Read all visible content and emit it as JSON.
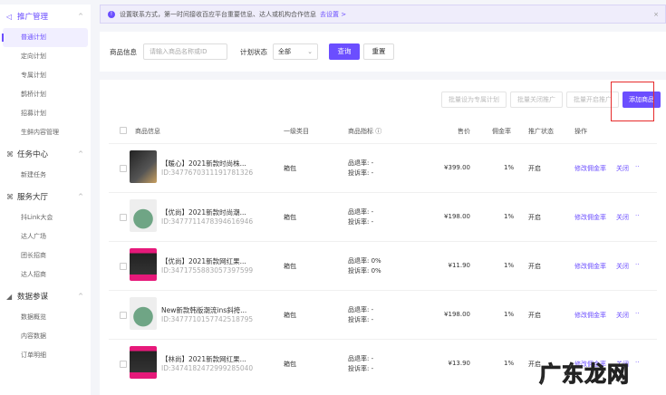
{
  "sidebar": {
    "groups": [
      {
        "label": "推广管理",
        "icon": "megaphone-icon",
        "items": [
          "普通计划",
          "定向计划",
          "专属计划",
          "鹊桥计划",
          "招募计划",
          "生鲜内容管理"
        ]
      },
      {
        "label": "任务中心",
        "icon": "grid-icon",
        "items": [
          "新建任务"
        ]
      },
      {
        "label": "服务大厅",
        "icon": "grid-icon",
        "items": [
          "抖Link大会",
          "达人广场",
          "团长招商",
          "达人招商"
        ]
      },
      {
        "label": "数据参谋",
        "icon": "chart-icon",
        "items": [
          "数据概览",
          "内容数据",
          "订单明细"
        ]
      }
    ]
  },
  "banner": {
    "text": "设置联系方式，第一时间接收百应平台重要信息、达人或机构合作信息",
    "link": "去设置 >",
    "close": "×"
  },
  "filter": {
    "product_label": "商品信息",
    "product_placeholder": "请输入商品名称或ID",
    "status_label": "计划状态",
    "status_value": "全部",
    "query": "查询",
    "reset": "重置"
  },
  "actions": {
    "batch_exclusive": "批量设为专属计划",
    "batch_close": "批量关闭推广",
    "batch_open": "批量开启推广",
    "add": "添加商品"
  },
  "table": {
    "headers": [
      "商品信息",
      "一级类目",
      "商品指标 ⓘ",
      "售价",
      "佣金率",
      "推广状态",
      "操作"
    ],
    "rows": [
      {
        "name": "【暖心】2021新款时尚株...",
        "id": "ID:3477670311191781326",
        "category": "箱包",
        "refund": "品退率: -",
        "complaint": "投诉率: -",
        "price": "¥399.00",
        "rate": "1%",
        "status": "开启",
        "thumb": "t1"
      },
      {
        "name": "【优尚】2021新款时尚潮...",
        "id": "ID:3477711478394616946",
        "category": "箱包",
        "refund": "品退率: -",
        "complaint": "投诉率: -",
        "price": "¥198.00",
        "rate": "1%",
        "status": "开启",
        "thumb": "t2"
      },
      {
        "name": "【优尚】2021新款网红果...",
        "id": "ID:3471755883057397599",
        "category": "箱包",
        "refund": "品退率: 0%",
        "complaint": "投诉率: 0%",
        "price": "¥11.90",
        "rate": "1%",
        "status": "开启",
        "thumb": "t3"
      },
      {
        "name": "New新款韩版潮流ins斜挎...",
        "id": "ID:3477710157742518795",
        "category": "箱包",
        "refund": "品退率: -",
        "complaint": "投诉率: -",
        "price": "¥198.00",
        "rate": "1%",
        "status": "开启",
        "thumb": "t2"
      },
      {
        "name": "【林尚】2021新款网红果...",
        "id": "ID:3474182472999285040",
        "category": "箱包",
        "refund": "品退率: -",
        "complaint": "投诉率: -",
        "price": "¥13.90",
        "rate": "1%",
        "status": "开启",
        "thumb": "t3"
      }
    ],
    "op_edit": "修改佣金率",
    "op_close": "关闭",
    "op_more": "··"
  },
  "watermark": "广东龙网"
}
